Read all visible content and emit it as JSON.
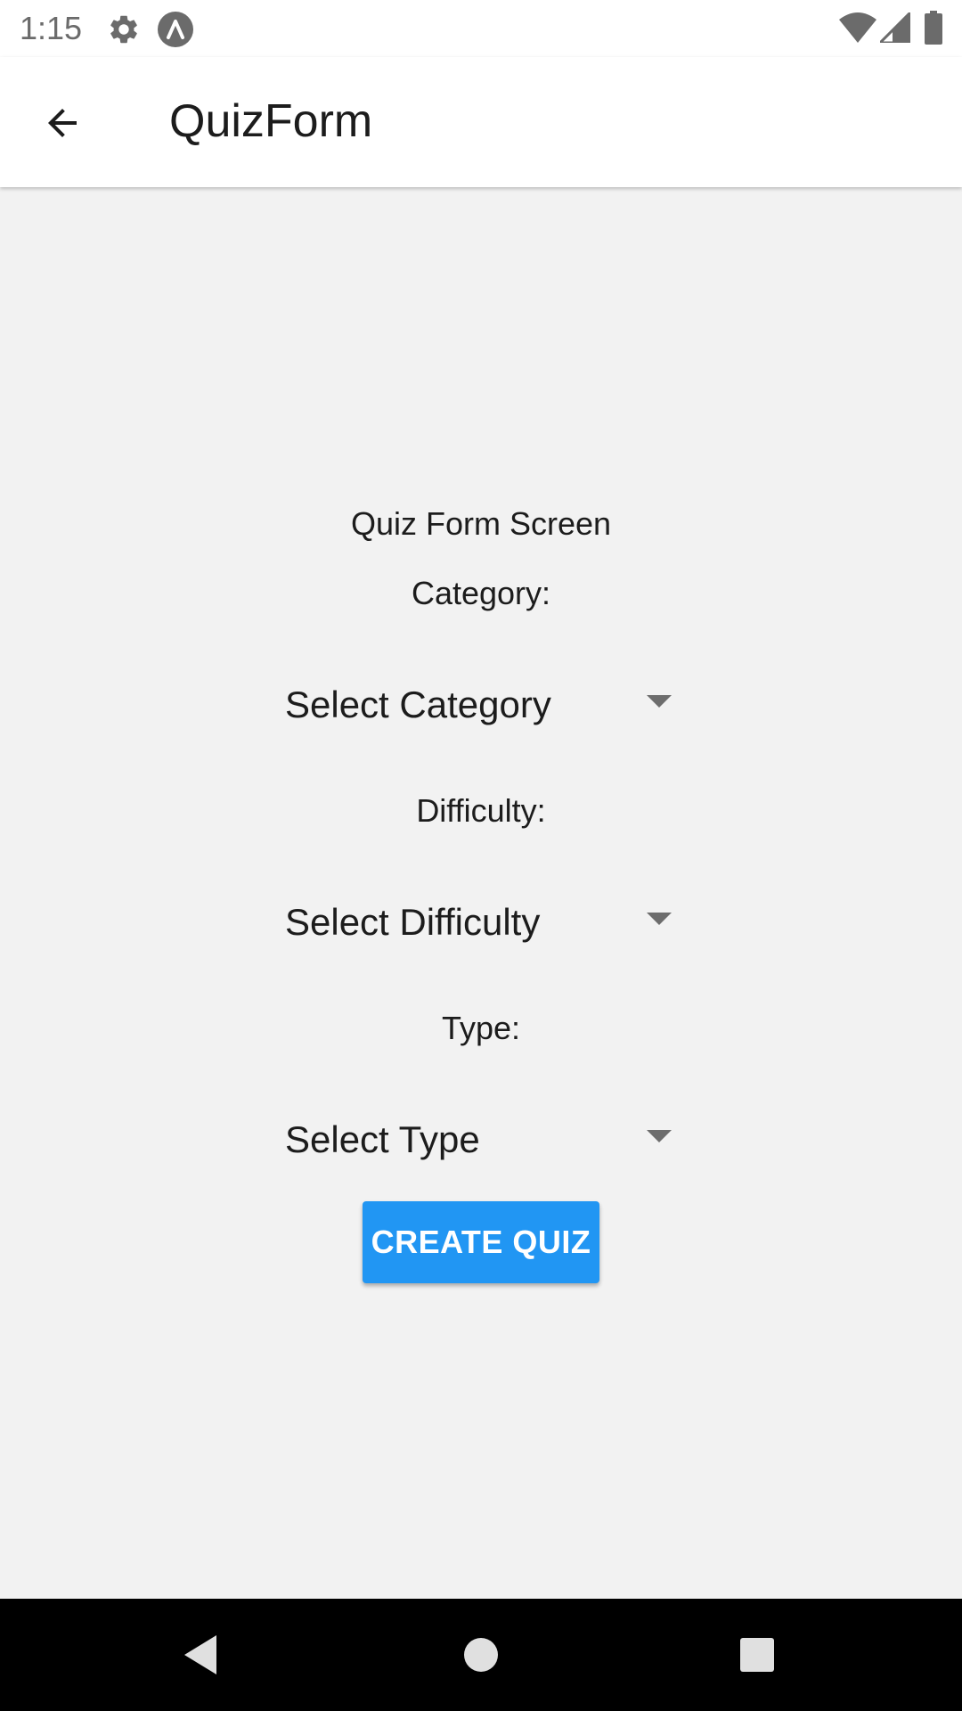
{
  "status_bar": {
    "time": "1:15",
    "icons": [
      "settings-icon",
      "app-notification-icon",
      "wifi-icon",
      "cellular-signal-icon",
      "battery-icon"
    ],
    "icon_color": "#6b6b6b"
  },
  "app_bar": {
    "title": "QuizForm",
    "back_icon": "arrow-left-icon",
    "background": "#ffffff"
  },
  "main": {
    "screen_title": "Quiz Form Screen",
    "fields": [
      {
        "label": "Category:",
        "placeholder": "Select Category"
      },
      {
        "label": "Difficulty:",
        "placeholder": "Select Difficulty"
      },
      {
        "label": "Type:",
        "placeholder": "Select Type"
      }
    ],
    "submit_label": "CREATE QUIZ",
    "submit_color": "#2196f3",
    "background": "#f2f2f2"
  },
  "nav_bar": {
    "buttons": [
      "back-triangle-icon",
      "home-circle-icon",
      "recents-square-icon"
    ],
    "background": "#000000"
  }
}
